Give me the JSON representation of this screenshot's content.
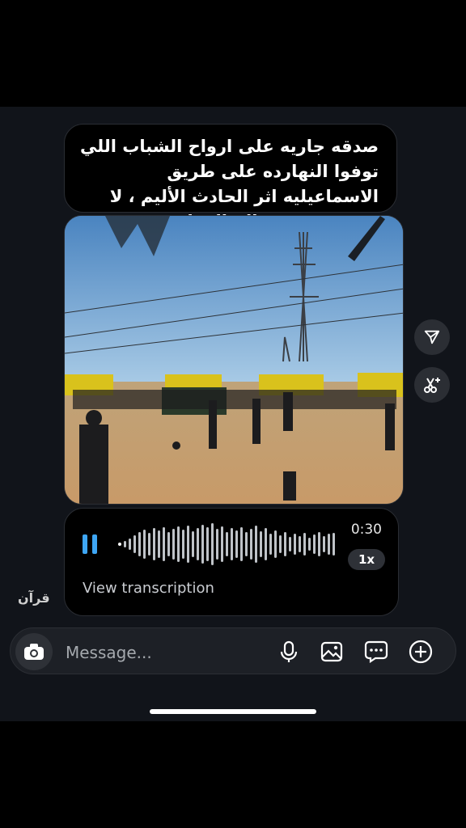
{
  "message": {
    "caption": "صدقه جاريه على ارواح الشباب اللي توفوا النهارده على طريق الاسماعيليه اثر الحادث الأليم ، لا تنسوهم من صالح الدعاء"
  },
  "audio": {
    "duration": "0:30",
    "speed": "1x",
    "transcription_link": "View transcription",
    "state": "playing"
  },
  "sender": {
    "label": "قرآن"
  },
  "side_actions": [
    {
      "icon": "share-icon"
    },
    {
      "icon": "ai-sparkle-scissors-icon"
    }
  ],
  "composer": {
    "placeholder": "Message...",
    "icons": [
      "camera-icon",
      "microphone-icon",
      "gallery-icon",
      "sticker-icon",
      "add-icon"
    ]
  },
  "colors": {
    "accent": "#3ea6f4",
    "bubble": "#000000",
    "background": "#11141a"
  }
}
